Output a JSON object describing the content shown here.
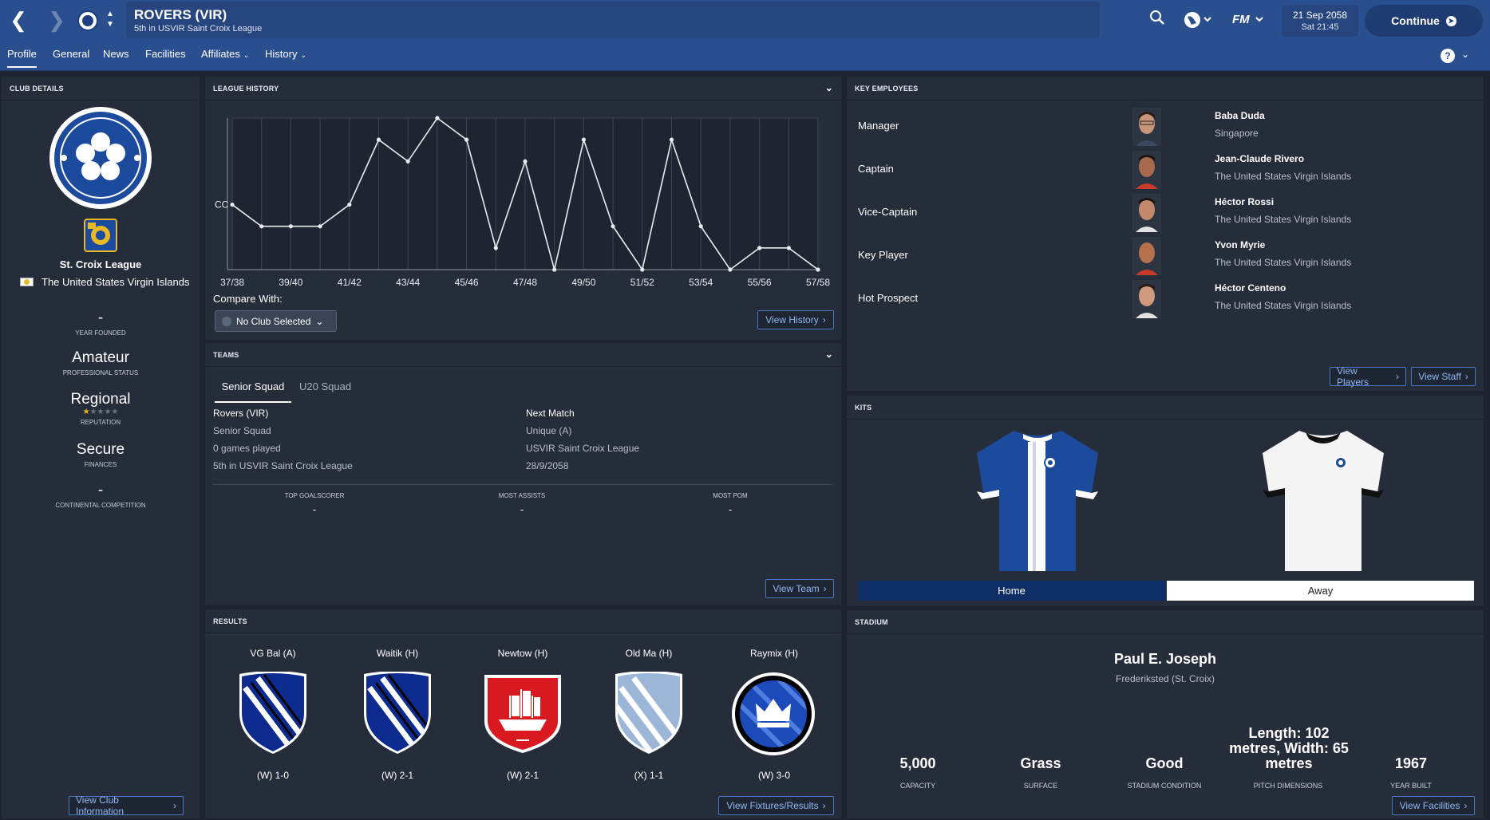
{
  "header": {
    "club_title": "ROVERS (VIR)",
    "club_subtitle": "5th in USVIR Saint Croix League",
    "date": "21 Sep 2058",
    "time": "Sat 21:45",
    "continue_label": "Continue",
    "icons": [
      "back-icon",
      "forward-icon",
      "club-crest-icon",
      "search-icon",
      "globe-icon",
      "fm-icon"
    ]
  },
  "tabs": {
    "profile": "Profile",
    "general": "General",
    "news": "News",
    "facilities": "Facilities",
    "affiliates": "Affiliates",
    "history": "History",
    "help": "?"
  },
  "club_details": {
    "heading": "CLUB DETAILS",
    "league": "St. Croix League",
    "nation": "The United States Virgin Islands",
    "year_founded": "-",
    "year_founded_label": "YEAR FOUNDED",
    "professional_status": "Amateur",
    "professional_status_label": "PROFESSIONAL STATUS",
    "reputation": "Regional",
    "reputation_stars": 0.5,
    "reputation_label": "REPUTATION",
    "finances": "Secure",
    "finances_label": "FINANCES",
    "continental": "-",
    "continental_label": "CONTINENTAL COMPETITION",
    "view_button": "View Club Information"
  },
  "league_history": {
    "heading": "LEAGUE HISTORY",
    "compare_label": "Compare With:",
    "compare_value": "No Club Selected",
    "view_button": "View History"
  },
  "chart_data": {
    "type": "line",
    "title": "",
    "x": [
      "37/38",
      "38/39",
      "39/40",
      "40/41",
      "41/42",
      "42/43",
      "43/44",
      "44/45",
      "45/46",
      "46/47",
      "47/48",
      "48/49",
      "49/50",
      "50/51",
      "51/52",
      "52/53",
      "53/54",
      "54/55",
      "55/56",
      "56/57",
      "57/58"
    ],
    "x_tick_labels": [
      "37/38",
      "39/40",
      "41/42",
      "43/44",
      "45/46",
      "47/48",
      "49/50",
      "51/52",
      "53/54",
      "55/56",
      "57/58"
    ],
    "y_label_mark": "CC",
    "series": [
      {
        "values": [
          4,
          5,
          5,
          5,
          4,
          1,
          2,
          0,
          1,
          6,
          2,
          7,
          1,
          5,
          7,
          1,
          5,
          7,
          6,
          6,
          7
        ]
      }
    ],
    "note_scale": "position rank: 0 = top, 7 = bottom; CC level at 5",
    "grid": true
  },
  "teams": {
    "heading": "TEAMS",
    "tab_senior": "Senior Squad",
    "tab_u20": "U20 Squad",
    "team_name": "Rovers (VIR)",
    "team_type": "Senior Squad",
    "games_played": "0 games played",
    "league_position": "5th in USVIR Saint Croix League",
    "next_match_label": "Next Match",
    "next_opponent": "Unique (A)",
    "next_competition": "USVIR Saint Croix League",
    "next_date": "28/9/2058",
    "top_goalscorer_label": "TOP GOALSCORER",
    "top_goalscorer": "-",
    "most_assists_label": "MOST ASSISTS",
    "most_assists": "-",
    "most_pom_label": "MOST POM",
    "most_pom": "-",
    "view_button": "View Team"
  },
  "results": {
    "heading": "RESULTS",
    "items": [
      {
        "team": "VG Bal (A)",
        "score": "(W) 1-0",
        "crest": "blue-stripe-shield-icon"
      },
      {
        "team": "Waitik (H)",
        "score": "(W) 2-1",
        "crest": "blue-stripe-shield-icon"
      },
      {
        "team": "Newtow (H)",
        "score": "(W) 2-1",
        "crest": "red-ship-shield-icon"
      },
      {
        "team": "Old Ma (H)",
        "score": "(X) 1-1",
        "crest": "lightblue-stripe-shield-icon"
      },
      {
        "team": "Raymix (H)",
        "score": "(W) 3-0",
        "crest": "crown-roundel-icon"
      }
    ],
    "view_button": "View Fixtures/Results"
  },
  "key_employees": {
    "heading": "KEY EMPLOYEES",
    "rows": [
      {
        "role": "Manager",
        "name": "Baba Duda",
        "nation": "Singapore"
      },
      {
        "role": "Captain",
        "name": "Jean-Claude Rivero",
        "nation": "The United States Virgin Islands"
      },
      {
        "role": "Vice-Captain",
        "name": "Héctor Rossi",
        "nation": "The United States Virgin Islands"
      },
      {
        "role": "Key Player",
        "name": "Yvon Myrie",
        "nation": "The United States Virgin Islands"
      },
      {
        "role": "Hot Prospect",
        "name": "Héctor Centeno",
        "nation": "The United States Virgin Islands"
      }
    ],
    "view_players": "View Players",
    "view_staff": "View Staff"
  },
  "kits": {
    "heading": "KITS",
    "home": "Home",
    "away": "Away",
    "colors": {
      "home_primary": "#1c4a9c",
      "home_stripe": "#ffffff",
      "away_primary": "#f4f4f4",
      "away_trim": "#111111",
      "home_tab": "#0f2e66"
    }
  },
  "stadium": {
    "heading": "STADIUM",
    "name": "Paul E. Joseph",
    "location": "Frederiksted (St. Croix)",
    "capacity": "5,000",
    "capacity_label": "CAPACITY",
    "surface": "Grass",
    "surface_label": "SURFACE",
    "condition": "Good",
    "condition_label": "STADIUM CONDITION",
    "pitch": "Length: 102 metres, Width: 65 metres",
    "pitch_label": "PITCH DIMENSIONS",
    "year_built": "1967",
    "year_built_label": "YEAR BUILT",
    "view_button": "View Facilities"
  },
  "colors": {
    "accent": "#2a4f8e",
    "panel": "#262d3a",
    "background": "#1d2430",
    "link": "#8fb6f0"
  }
}
